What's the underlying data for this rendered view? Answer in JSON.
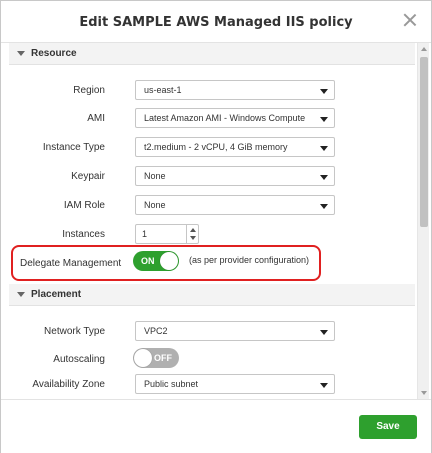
{
  "dialog": {
    "title": "Edit SAMPLE AWS Managed IIS policy"
  },
  "resource": {
    "section_label": "Resource",
    "region": {
      "label": "Region",
      "value": "us-east-1"
    },
    "ami": {
      "label": "AMI",
      "value": "Latest Amazon AMI - Windows Compute"
    },
    "instance_type": {
      "label": "Instance Type",
      "value": "t2.medium - 2 vCPU, 4 GiB memory"
    },
    "keypair": {
      "label": "Keypair",
      "value": "None"
    },
    "iam_role": {
      "label": "IAM Role",
      "value": "None"
    },
    "instances": {
      "label": "Instances",
      "value": "1"
    },
    "delegate_management": {
      "label": "Delegate Management",
      "state": "ON",
      "hint": "(as per provider configuration)"
    }
  },
  "placement": {
    "section_label": "Placement",
    "network_type": {
      "label": "Network Type",
      "value": "VPC2"
    },
    "autoscaling": {
      "label": "Autoscaling",
      "state": "OFF"
    },
    "availability_zone": {
      "label": "Availability Zone",
      "value": "Public subnet"
    }
  },
  "footer": {
    "save_label": "Save"
  },
  "colors": {
    "accent_green": "#2ea02e",
    "highlight_red": "#e02020"
  }
}
